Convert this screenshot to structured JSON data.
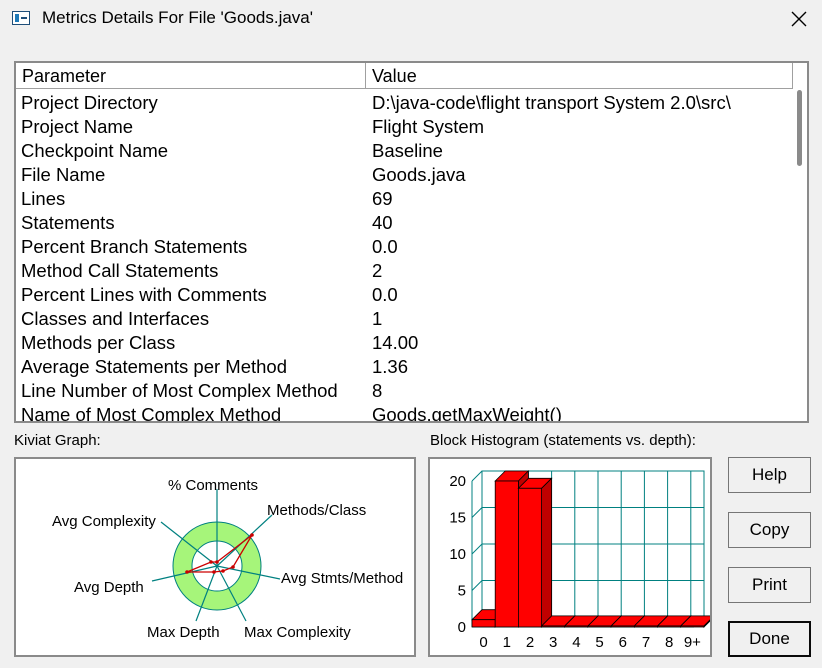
{
  "window": {
    "title": "Metrics Details For File 'Goods.java'"
  },
  "table": {
    "headers": [
      "Parameter",
      "Value"
    ],
    "rows": [
      {
        "param": "Project Directory",
        "value": "D:\\java-code\\flight transport System 2.0\\src\\"
      },
      {
        "param": "Project Name",
        "value": "Flight System"
      },
      {
        "param": "Checkpoint Name",
        "value": "Baseline"
      },
      {
        "param": "File Name",
        "value": "Goods.java"
      },
      {
        "param": "Lines",
        "value": "69"
      },
      {
        "param": "Statements",
        "value": "40"
      },
      {
        "param": "Percent Branch Statements",
        "value": "0.0"
      },
      {
        "param": "Method Call Statements",
        "value": "2"
      },
      {
        "param": "Percent Lines with Comments",
        "value": "0.0"
      },
      {
        "param": "Classes and Interfaces",
        "value": "1"
      },
      {
        "param": "Methods per Class",
        "value": "14.00"
      },
      {
        "param": "Average Statements per Method",
        "value": "1.36"
      },
      {
        "param": "Line Number of Most Complex Method",
        "value": "8"
      },
      {
        "param": "Name of Most Complex Method",
        "value": "Goods.getMaxWeight()"
      }
    ]
  },
  "kiviat": {
    "label": "Kiviat Graph:",
    "axes": [
      "% Comments",
      "Methods/Class",
      "Avg Stmts/Method",
      "Max Complexity",
      "Max Depth",
      "Avg Depth",
      "Avg Complexity"
    ],
    "ring_color": "#a6f57a",
    "axis_color": "#008080",
    "value_color": "#cc0000"
  },
  "histogram": {
    "label": "Block Histogram (statements vs. depth):",
    "bar_color": "#ff0000",
    "grid_color": "#008080"
  },
  "chart_data": {
    "type": "bar",
    "categories": [
      "0",
      "1",
      "2",
      "3",
      "4",
      "5",
      "6",
      "7",
      "8",
      "9+"
    ],
    "values": [
      1,
      20,
      19,
      0,
      0,
      0,
      0,
      0,
      0,
      0
    ],
    "yticks": [
      "0",
      "5",
      "10",
      "15",
      "20"
    ],
    "ylim": [
      0,
      20
    ]
  },
  "buttons": {
    "help": "Help",
    "copy": "Copy",
    "print": "Print",
    "done": "Done"
  }
}
